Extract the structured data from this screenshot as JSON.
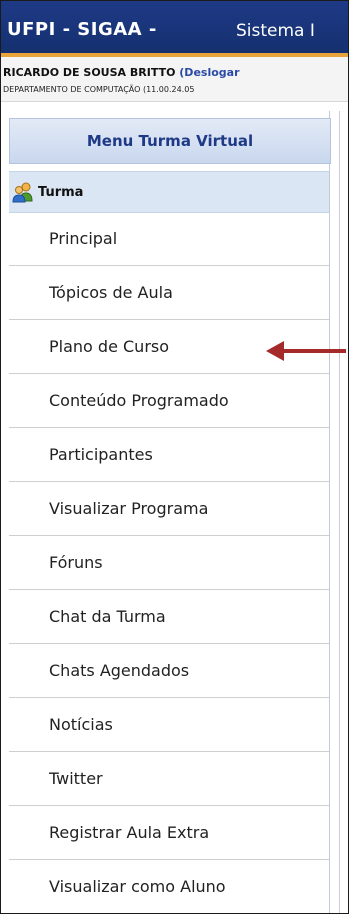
{
  "header": {
    "brand": "UFPI - SIGAA -",
    "system": "Sistema I"
  },
  "user": {
    "name": "RICARDO DE SOUSA BRITTO",
    "logout": "(Deslogar",
    "department": "DEPARTAMENTO DE COMPUTAÇÃO (11.00.24.05"
  },
  "menu": {
    "title": "Menu Turma Virtual",
    "section": {
      "label": "Turma",
      "icon": "users-icon"
    },
    "items": [
      "Principal",
      "Tópicos de Aula",
      "Plano de Curso",
      "Conteúdo Programado",
      "Participantes",
      "Visualizar Programa",
      "Fóruns",
      "Chat da Turma",
      "Chats Agendados",
      "Notícias",
      "Twitter",
      "Registrar Aula Extra",
      "Visualizar como Aluno"
    ]
  },
  "colors": {
    "topbar": "#1e3a86",
    "accent_line": "#e8a33a",
    "menu_header_text": "#1e3a86",
    "arrow": "#a52a2a"
  }
}
